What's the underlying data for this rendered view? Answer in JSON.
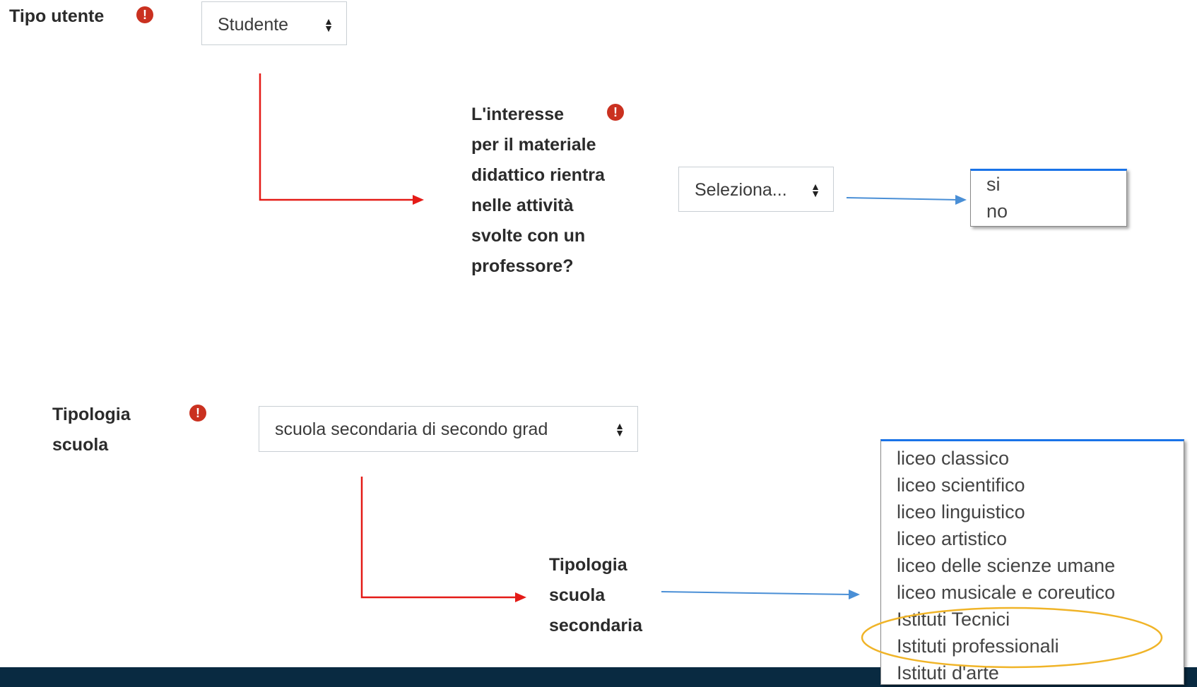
{
  "tipo_utente": {
    "label": "Tipo utente",
    "required_icon": "exclamation-circle-icon",
    "selected": "Studente"
  },
  "interesse": {
    "label_lines": [
      "L'interesse",
      "per il materiale",
      "didattico rientra",
      "nelle attività",
      "svolte con un",
      "professore?"
    ],
    "required_icon": "exclamation-circle-icon",
    "selected": "Seleziona...",
    "options": [
      "si",
      "no"
    ]
  },
  "tipologia_scuola": {
    "label_lines": [
      "Tipologia",
      "scuola"
    ],
    "required_icon": "exclamation-circle-icon",
    "selected": "scuola secondaria di secondo grad"
  },
  "tipologia_secondaria": {
    "label_lines": [
      "Tipologia",
      "scuola",
      "secondaria"
    ],
    "options": [
      "liceo classico",
      "liceo scientifico",
      "liceo linguistico",
      "liceo artistico",
      "liceo delle scienze umane",
      "liceo musicale e coreutico",
      "Istituti Tecnici",
      "Istituti professionali",
      "Istituti d'arte"
    ],
    "highlighted": [
      "Istituti Tecnici",
      "Istituti professionali"
    ]
  },
  "colors": {
    "required": "#ca3120",
    "red_arrow": "#e41b17",
    "blue_arrow": "#4a8fd6",
    "highlight_ellipse": "#f0b428",
    "dropdown_border_top": "#1a73e8",
    "footer": "#092a41"
  }
}
